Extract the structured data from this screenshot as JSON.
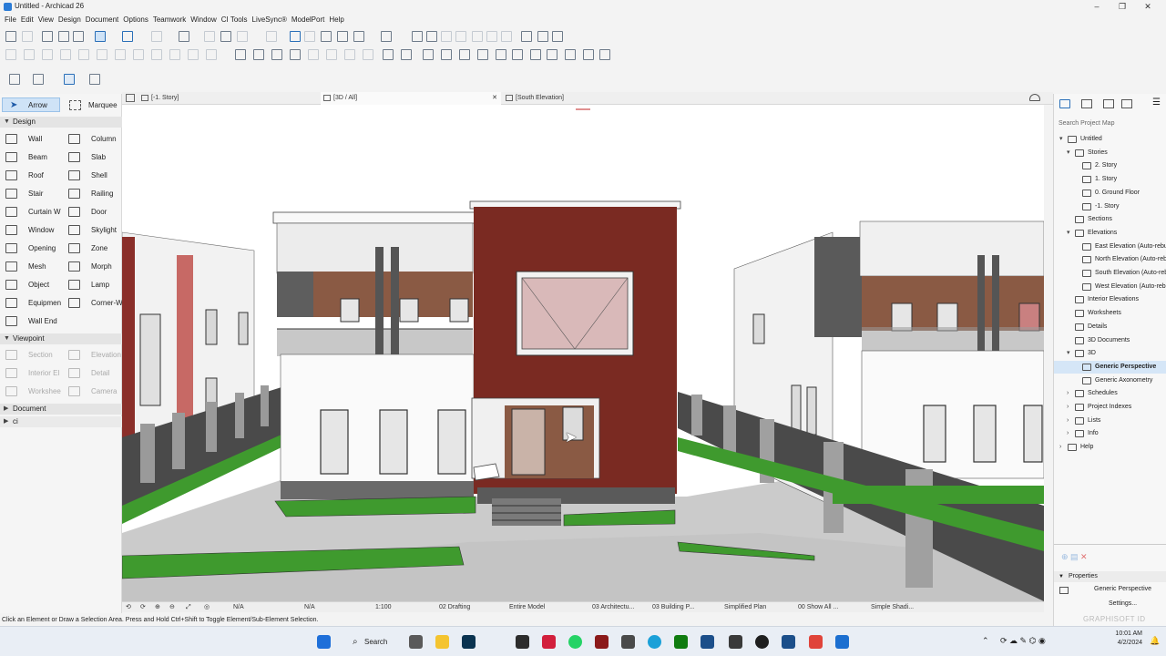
{
  "window": {
    "title": "Untitled - Archicad 26",
    "minimize": "–",
    "restore": "❐",
    "close": "✕"
  },
  "menu": [
    "File",
    "Edit",
    "View",
    "Design",
    "Document",
    "Options",
    "Teamwork",
    "Window",
    "CI Tools",
    "LiveSync®",
    "ModelPort",
    "Help"
  ],
  "toolbox": {
    "arrow": "Arrow",
    "marquee": "Marquee",
    "design_header": "Design",
    "tools": [
      [
        "Wall",
        "Column"
      ],
      [
        "Beam",
        "Slab"
      ],
      [
        "Roof",
        "Shell"
      ],
      [
        "Stair",
        "Railing"
      ],
      [
        "Curtain W",
        "Door"
      ],
      [
        "Window",
        "Skylight"
      ],
      [
        "Opening",
        "Zone"
      ],
      [
        "Mesh",
        "Morph"
      ],
      [
        "Object",
        "Lamp"
      ],
      [
        "Equipmen",
        "Corner-Wi"
      ],
      [
        "Wall End",
        ""
      ]
    ],
    "viewpoint_header": "Viewpoint",
    "viewpoint_tools": [
      [
        "Section",
        "Elevation"
      ],
      [
        "Interior El",
        "Detail"
      ],
      [
        "Workshee",
        "Camera"
      ]
    ],
    "document_header": "Document",
    "ci_header": "ci"
  },
  "tabs": [
    {
      "label": "[-1. Story]"
    },
    {
      "label": "[3D / All]"
    },
    {
      "label": "[South Elevation]"
    }
  ],
  "tab_close": "✕",
  "viewbar": {
    "na1": "N/A",
    "na2": "N/A",
    "scale": "1:100",
    "layer": "02 Drafting",
    "model": "Entire Model",
    "pen": "03 Architectu...",
    "mvo": "03 Building P...",
    "renovation": "Simplified Plan",
    "show": "00 Show All ...",
    "style": "Simple Shadi..."
  },
  "status": "Click an Element or Draw a Selection Area. Press and Hold Ctrl+Shift to Toggle Element/Sub-Element Selection.",
  "navigator": {
    "search_placeholder": "Search Project Map",
    "items": [
      {
        "label": "Untitled",
        "level": 0,
        "tri": "open"
      },
      {
        "label": "Stories",
        "level": 1,
        "tri": "open"
      },
      {
        "label": "2. Story",
        "level": 2,
        "tri": ""
      },
      {
        "label": "1. Story",
        "level": 2,
        "tri": ""
      },
      {
        "label": "0. Ground Floor",
        "level": 2,
        "tri": ""
      },
      {
        "label": "-1. Story",
        "level": 2,
        "tri": ""
      },
      {
        "label": "Sections",
        "level": 1,
        "tri": ""
      },
      {
        "label": "Elevations",
        "level": 1,
        "tri": "open"
      },
      {
        "label": "East Elevation (Auto-rebuild Model)",
        "level": 2,
        "tri": ""
      },
      {
        "label": "North Elevation (Auto-rebuild Model)",
        "level": 2,
        "tri": ""
      },
      {
        "label": "South Elevation (Auto-rebuild Model)",
        "level": 2,
        "tri": ""
      },
      {
        "label": "West Elevation (Auto-rebuild Model)",
        "level": 2,
        "tri": ""
      },
      {
        "label": "Interior Elevations",
        "level": 1,
        "tri": ""
      },
      {
        "label": "Worksheets",
        "level": 1,
        "tri": ""
      },
      {
        "label": "Details",
        "level": 1,
        "tri": ""
      },
      {
        "label": "3D Documents",
        "level": 1,
        "tri": ""
      },
      {
        "label": "3D",
        "level": 1,
        "tri": "open"
      },
      {
        "label": "Generic Perspective",
        "level": 2,
        "tri": "",
        "selected": true
      },
      {
        "label": "Generic Axonometry",
        "level": 2,
        "tri": ""
      },
      {
        "label": "Schedules",
        "level": 1,
        "tri": "closed"
      },
      {
        "label": "Project Indexes",
        "level": 1,
        "tri": "closed"
      },
      {
        "label": "Lists",
        "level": 1,
        "tri": "closed"
      },
      {
        "label": "Info",
        "level": 1,
        "tri": "closed"
      },
      {
        "label": "Help",
        "level": 0,
        "tri": "closed"
      }
    ],
    "properties_header": "Properties",
    "properties_value": "Generic Perspective",
    "settings": "Settings...",
    "brand": "GRAPHISOFT ID"
  },
  "taskbar": {
    "search": "Search",
    "time": "10:01 AM",
    "date": "4/2/2024"
  },
  "colors": {
    "accent": "#2a6fb8",
    "facade_red": "#7a2a22",
    "brick": "#8a5a44",
    "lawn": "#3f9a2e",
    "pavement": "#c9c9c9"
  }
}
